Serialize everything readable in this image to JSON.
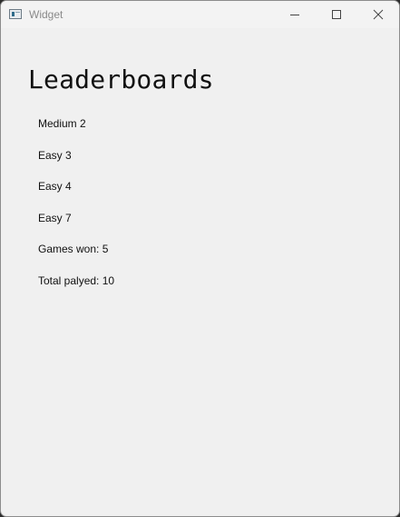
{
  "window": {
    "title": "Widget",
    "app_icon": "window-app-icon",
    "controls": {
      "minimize_icon": "minimize-icon",
      "maximize_icon": "maximize-icon",
      "close_icon": "close-icon"
    }
  },
  "main": {
    "heading": "Leaderboards",
    "stats": [
      "Medium 2",
      "Easy 3",
      "Easy 4",
      "Easy 7",
      "Games won: 5",
      "Total palyed: 10"
    ]
  },
  "colors": {
    "background": "#f0f0f0",
    "titlebar": "#f3f3f3",
    "text": "#111111",
    "title_text": "#8a8a8a"
  }
}
